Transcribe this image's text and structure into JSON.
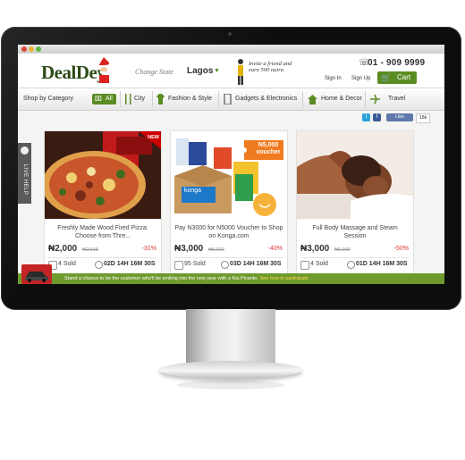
{
  "site": {
    "logo": "DealDey",
    "change_state": "Change State",
    "state": "Lagos",
    "promo": "Invite a friend and earn 500 naira",
    "phone": "01 - 909 9999",
    "sign_in": "Sign In",
    "sign_up": "Sign Up",
    "cart": "Cart"
  },
  "nav": {
    "shop_by_category": "Shop by Category",
    "all": "All",
    "items": [
      "City",
      "Fashion & Style",
      "Gadgets & Electronics",
      "Home & Decor",
      "Travel"
    ]
  },
  "social": {
    "like": "Like",
    "like_count": "18k"
  },
  "live_help": "LIVE HELP",
  "deals": [
    {
      "title": "Freshly Made Wood Fired Pizza: Choose from Thre...",
      "price": "₦2,000",
      "old_price": "₦2,668",
      "discount": "-31%",
      "sold": "4 Sold",
      "timer": "02D 14H 16M 30S",
      "badge": "NEW"
    },
    {
      "title": "Pay N3000 for N5000 Voucher to Shop on Konga.com",
      "price": "₦3,000",
      "old_price": "₦5,000",
      "discount": "-40%",
      "sold": "95 Sold",
      "timer": "03D 14H 16M 30S",
      "voucher": "N5,000 voucher",
      "brand": "konga"
    },
    {
      "title": "Full Body Massage and Steam Session",
      "price": "₦3,000",
      "old_price": "₦6,000",
      "discount": "-50%",
      "sold": "4 Sold",
      "timer": "01D 14H 16M 30S"
    }
  ],
  "banner": {
    "text": "Stand a chance to be the customer who'll be smiling into the new year with a Kia Picanto.",
    "link": "See how to participate."
  },
  "colors": {
    "accent": "#5b8c23",
    "discount": "#dd3333",
    "banner": "#6e9a2e"
  }
}
